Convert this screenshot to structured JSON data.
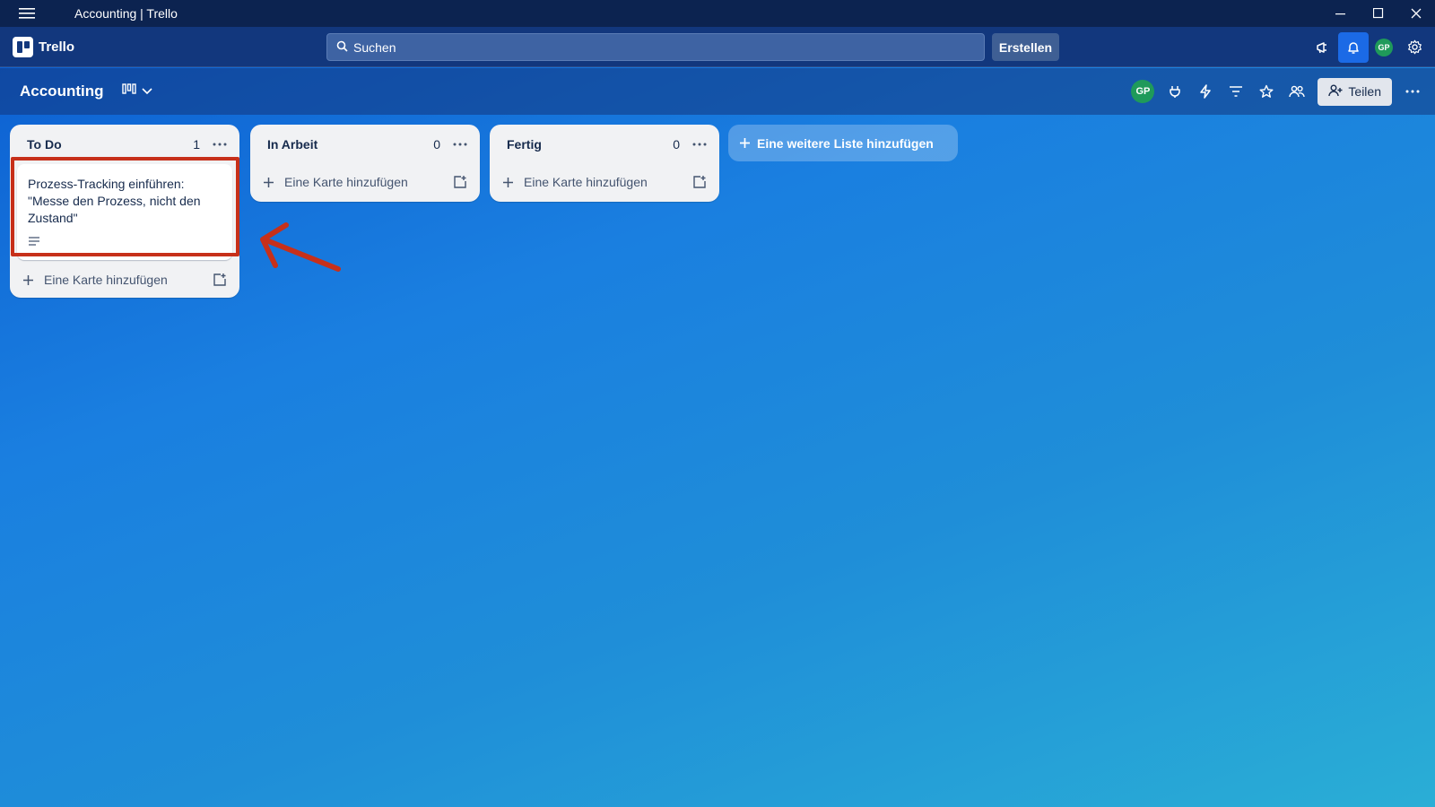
{
  "window": {
    "title": "Accounting | Trello"
  },
  "header": {
    "logo_text": "Trello",
    "search_placeholder": "Suchen",
    "create_label": "Erstellen",
    "avatar_initials": "GP"
  },
  "board": {
    "title": "Accounting",
    "member_initials": "GP",
    "share_label": "Teilen"
  },
  "lists": [
    {
      "title": "To Do",
      "count": "1",
      "cards": [
        {
          "title": "Prozess-Tracking einführen: \"Messe den Prozess, nicht den Zustand\""
        }
      ],
      "add_card_label": "Eine Karte hinzufügen"
    },
    {
      "title": "In Arbeit",
      "count": "0",
      "cards": [],
      "add_card_label": "Eine Karte hinzufügen"
    },
    {
      "title": "Fertig",
      "count": "0",
      "cards": [],
      "add_card_label": "Eine Karte hinzufügen"
    }
  ],
  "add_list_label": "Eine weitere Liste hinzufügen",
  "colors": {
    "annotation": "#c7301a",
    "header_bg": "#12377d",
    "titlebar_bg": "#0c2350",
    "notification_active": "#1b6ae6",
    "avatar": "#1f9a5a"
  },
  "icons": {
    "menu": "hamburger-icon",
    "search": "search-icon",
    "announce": "megaphone-icon",
    "notify": "bell-icon",
    "settings": "gear-icon",
    "view": "board-view-icon",
    "power_ups": "rocket-icon",
    "automation": "lightning-icon",
    "filter": "filter-icon",
    "star": "star-icon",
    "members": "people-icon"
  }
}
